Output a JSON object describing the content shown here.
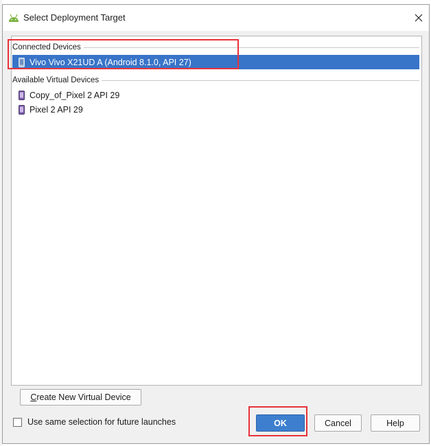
{
  "window": {
    "title": "Select Deployment Target",
    "title_icon": "android-icon",
    "close_icon": "close-icon"
  },
  "groups": [
    {
      "label": "Connected Devices",
      "devices": [
        {
          "label": "Vivo Vivo X21UD A (Android 8.1.0, API 27)",
          "icon": "phone-icon",
          "selected": true
        }
      ]
    },
    {
      "label": "Available Virtual Devices",
      "devices": [
        {
          "label": "Copy_of_Pixel 2 API 29",
          "icon": "virtual-phone-icon",
          "selected": false
        },
        {
          "label": "Pixel 2 API 29",
          "icon": "virtual-phone-icon",
          "selected": false
        }
      ]
    }
  ],
  "create_button": {
    "mnemonic": "C",
    "rest": "reate New Virtual Device"
  },
  "checkbox": {
    "label": "Use same selection for future launches",
    "checked": false
  },
  "buttons": {
    "ok": "OK",
    "cancel": "Cancel",
    "help": "Help"
  },
  "colors": {
    "selection": "#3874c8",
    "primary_button": "#3d7fce",
    "highlight_box": "#e8323a",
    "dialog_background": "#f0f0f0"
  }
}
